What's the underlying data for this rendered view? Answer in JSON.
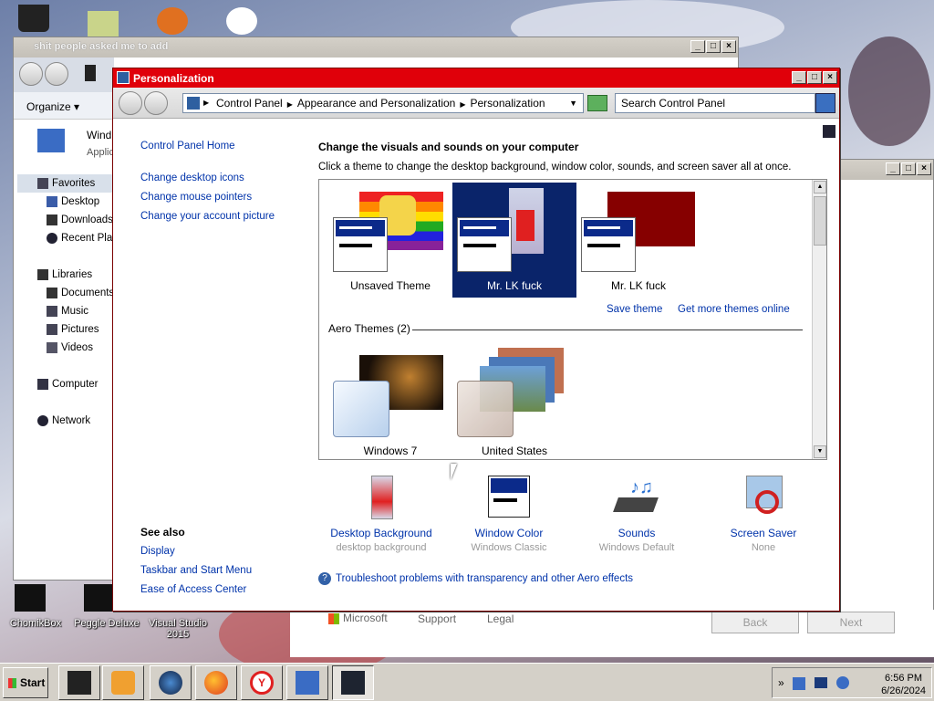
{
  "desktop": {
    "icons_bottom": [
      "ChomikBox",
      "Peggle Deluxe",
      "Visual Studio 2015"
    ]
  },
  "explorer_window": {
    "title": "shit people asked me to add",
    "organize": "Organize",
    "item_title": "Wind",
    "item_sub": "Applic",
    "nav": [
      {
        "label": "Favorites",
        "type": "header"
      },
      {
        "label": "Desktop",
        "type": "item"
      },
      {
        "label": "Downloads",
        "type": "item"
      },
      {
        "label": "Recent Plac",
        "type": "item"
      },
      {
        "label": "Libraries",
        "type": "header"
      },
      {
        "label": "Documents",
        "type": "item"
      },
      {
        "label": "Music",
        "type": "item"
      },
      {
        "label": "Pictures",
        "type": "item"
      },
      {
        "label": "Videos",
        "type": "item"
      },
      {
        "label": "Computer",
        "type": "header"
      },
      {
        "label": "Network",
        "type": "header"
      }
    ]
  },
  "personalization": {
    "title": "Personalization",
    "breadcrumb": [
      "Control Panel",
      "Appearance and Personalization",
      "Personalization"
    ],
    "search_placeholder": "Search Control Panel",
    "left_links": [
      "Control Panel Home",
      "Change desktop icons",
      "Change mouse pointers",
      "Change your account picture"
    ],
    "see_also_title": "See also",
    "see_also": [
      "Display",
      "Taskbar and Start Menu",
      "Ease of Access Center"
    ],
    "heading": "Change the visuals and sounds on your computer",
    "subheading": "Click a theme to change the desktop background, window color, sounds, and screen saver all at once.",
    "my_themes": [
      {
        "name": "Unsaved Theme",
        "selected": false
      },
      {
        "name": "Mr. LK fuck",
        "selected": true
      },
      {
        "name": "Mr. LK fuck",
        "selected": false
      }
    ],
    "save_theme": "Save theme",
    "get_more": "Get more themes online",
    "aero_group": "Aero Themes (2)",
    "aero_themes": [
      {
        "name": "Windows 7"
      },
      {
        "name": "United States"
      }
    ],
    "options": [
      {
        "label": "Desktop Background",
        "value": "desktop background",
        "icon": "desktop-background-icon"
      },
      {
        "label": "Window Color",
        "value": "Windows Classic",
        "icon": "window-color-icon"
      },
      {
        "label": "Sounds",
        "value": "Windows Default",
        "icon": "sounds-icon"
      },
      {
        "label": "Screen Saver",
        "value": "None",
        "icon": "screen-saver-icon"
      }
    ],
    "troubleshoot": "Troubleshoot problems with transparency and other Aero effects"
  },
  "ms_page": {
    "brand": "Microsoft",
    "support": "Support",
    "legal": "Legal",
    "back": "Back",
    "next": "Next"
  },
  "taskbar": {
    "start": "Start",
    "time": "6:56 PM",
    "date": "6/26/2024",
    "tray_chevron": "»"
  },
  "colors": {
    "titlebar_active": "#e0000a",
    "selection": "#0a246a",
    "link": "#0033aa"
  }
}
